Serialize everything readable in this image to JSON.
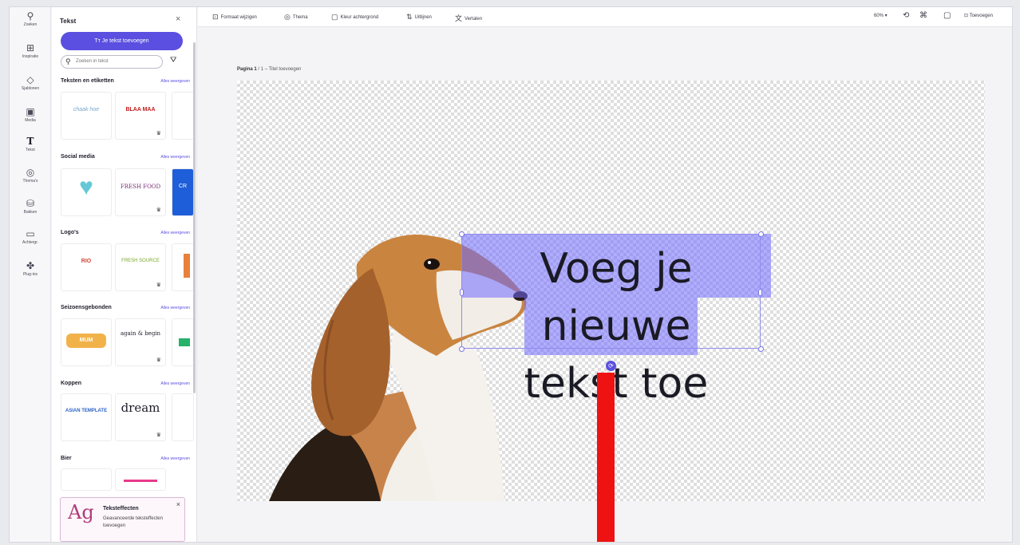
{
  "rail": [
    {
      "icon": "⚲",
      "label": "Zoeken",
      "icon_name": "search-icon"
    },
    {
      "icon": "⊞",
      "label": "Inspiratie",
      "icon_name": "template-icon"
    },
    {
      "icon": "◇",
      "label": "Sjablonen",
      "icon_name": "shapes-icon"
    },
    {
      "icon": "▣",
      "label": "Media",
      "icon_name": "media-icon"
    },
    {
      "icon": "T",
      "label": "Tekst",
      "icon_name": "text-icon"
    },
    {
      "icon": "◎",
      "label": "Thema's",
      "icon_name": "theme-icon"
    },
    {
      "icon": "⛁",
      "label": "Bakken",
      "icon_name": "data-icon"
    },
    {
      "icon": "▭",
      "label": "Achtergr.",
      "icon_name": "background-icon"
    },
    {
      "icon": "✤",
      "label": "Plug-ins",
      "icon_name": "plugin-icon"
    }
  ],
  "panel": {
    "title": "Tekst",
    "close": "×",
    "add_button": "Tт Je tekst toevoegen",
    "search_placeholder": "Zoeken in tekst",
    "filter_icon": "⛛",
    "sections": [
      {
        "title": "Teksten en etiketten",
        "see_all": "Alles weergeven",
        "thumbs": [
          "chaak hoe",
          "BLAA MAA",
          ""
        ]
      },
      {
        "title": "Social media",
        "see_all": "Alles weergeven",
        "thumbs": [
          "♥",
          "FRESH FOOD",
          "CR"
        ]
      },
      {
        "title": "Logo's",
        "see_all": "Alles weergeven",
        "thumbs": [
          "RIO",
          "FRESH SOURCE",
          ""
        ]
      },
      {
        "title": "Seizoensgebonden",
        "see_all": "Alles weergeven",
        "thumbs": [
          "MUM",
          "again & begin",
          ""
        ]
      },
      {
        "title": "Koppen",
        "see_all": "Alles weergeven",
        "thumbs": [
          "ASIAN TEMPLATE",
          "dream",
          ""
        ]
      },
      {
        "title": "Bier",
        "see_all": "Alles weergeven",
        "thumbs": [
          "",
          "",
          ""
        ]
      }
    ],
    "promo": {
      "big": "Ag",
      "title": "Teksteffecten",
      "desc": "Geavanceerde teksteffecten toevoegen",
      "close": "×"
    }
  },
  "toolbar": {
    "items": [
      {
        "icon": "⊡",
        "label": "Formaat wijzigen"
      },
      {
        "icon": "◎",
        "label": "Thema"
      },
      {
        "icon": "▢",
        "label": "Kleur achtergrond"
      },
      {
        "icon": "⇅",
        "label": "Uitlijnen"
      },
      {
        "icon": "文",
        "label": "Vertalen"
      }
    ],
    "zoom": "60% ▾",
    "right_icons": [
      "⟲",
      "⌘",
      "▢"
    ],
    "share": "⊡ Toevoegen"
  },
  "canvas": {
    "breadcrumb_page": "Pagina 1",
    "breadcrumb_rest": " / 1 – Titel toevoegen",
    "text_line1": "Voeg je nieuwe",
    "text_line2": "tekst toe",
    "rotate_icon": "⟳"
  },
  "colors": {
    "accent": "#5a4fe0",
    "selection": "#7067ff",
    "red_bar": "#ee1212"
  }
}
